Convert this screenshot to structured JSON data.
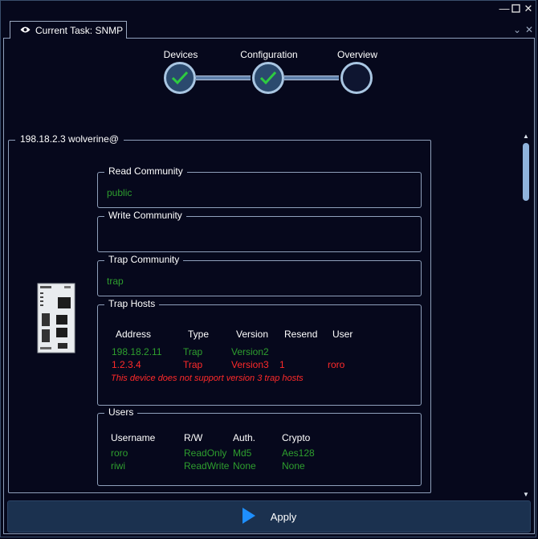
{
  "window": {
    "controls": {
      "minimize_icon": "minimize-icon",
      "maximize_icon": "maximize-icon",
      "close_icon": "close-icon"
    }
  },
  "tab": {
    "label": "Current Task: SNMP",
    "icon": "eye-icon"
  },
  "stepper": {
    "steps": [
      {
        "label": "Devices",
        "done": true
      },
      {
        "label": "Configuration",
        "done": true
      },
      {
        "label": "Overview",
        "done": false
      }
    ]
  },
  "device": {
    "title": "198.18.2.3 wolverine@",
    "read_community": {
      "label": "Read Community",
      "value": "public"
    },
    "write_community": {
      "label": "Write Community",
      "value": ""
    },
    "trap_community": {
      "label": "Trap Community",
      "value": "trap"
    },
    "trap_hosts": {
      "label": "Trap Hosts",
      "headers": [
        "Address",
        "Type",
        "Version",
        "Resend",
        "User"
      ],
      "rows": [
        {
          "address": "198.18.2.11",
          "type": "Trap",
          "version": "Version2",
          "resend": "",
          "user": "",
          "status": "ok"
        },
        {
          "address": "1.2.3.4",
          "type": "Trap",
          "version": "Version3",
          "resend": "1",
          "user": "roro",
          "status": "error"
        }
      ],
      "warning": "This device does not support version 3 trap hosts"
    },
    "users": {
      "label": "Users",
      "headers": [
        "Username",
        "R/W",
        "Auth.",
        "Crypto"
      ],
      "rows": [
        {
          "username": "roro",
          "rw": "ReadOnly",
          "auth": "Md5",
          "crypto": "Aes128"
        },
        {
          "username": "riwi",
          "rw": "ReadWrite",
          "auth": "None",
          "crypto": "None"
        }
      ]
    }
  },
  "apply_button": {
    "label": "Apply",
    "icon": "play-icon"
  },
  "colors": {
    "background": "#06081c",
    "ok": "#2e9e2e",
    "error": "#ff2a2a",
    "accent": "#a9c6e2"
  }
}
